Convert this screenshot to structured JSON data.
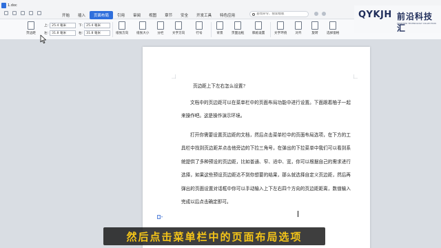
{
  "window": {
    "doc_tab": "1.doc"
  },
  "menu": {
    "tabs": [
      "开始",
      "插入",
      "页面布局",
      "引用",
      "审阅",
      "视图",
      "章节",
      "安全",
      "开发工具",
      "特色应用"
    ],
    "active_tab": "页面布局",
    "search_placeholder": "查找命令、搜索模板"
  },
  "logo": {
    "latin": "QYKJH",
    "chinese": "前沿科技汇",
    "tagline": "FRONTIER TECHNOLOGY COLLECTION"
  },
  "ribbon": {
    "page_margin_label": "页边距",
    "top_key": "上:",
    "top_value": "25.4 毫米",
    "bottom_key": "下:",
    "bottom_value": "25.4 毫米",
    "left_key": "左:",
    "left_value": "31.8 毫米",
    "right_key": "右:",
    "right_value": "31.8 毫米",
    "orientation_label": "纸张方向",
    "size_label": "纸张大小",
    "columns_label": "分栏",
    "text_direction_label": "文字方向",
    "line_number_label": "行号",
    "background_label": "背景",
    "page_border_label": "页面边框",
    "draft_label": "稿纸设置",
    "wrap_label": "文字环绕",
    "align_label": "对齐",
    "rotate_label": "旋转",
    "select_pane_label": "选择窗格"
  },
  "document": {
    "title": "页边距上下左右怎么设置?",
    "paragraph1": "文档中的页边距可以在菜单栏中的页面布局功能中进行设置。下面跟着柚子一起来操作吧。这是操作演示环境。",
    "paragraph2": "打开你需要设置页边距的文档，然后点击菜单栏中的页面布局选项，在下方的工具栏中找到页边距并点击他旁边的下拉三角号，在弹出的下拉菜单中我们可以看到系统提供了多种预设的页边距，比如普通、窄、适中、宽，你可以根据自己的需求进行选择，如果这些预设页边距达不到你想要的结果，那么就选择自定义页边距，然后再弹出的页面设置对话框中你可以手动输入上下左右四个方向的页边距距离，数值输入完成以后点击确定即可。"
  },
  "subtitle": {
    "text": "然后点击菜单栏中的页面布局选项"
  },
  "colors": {
    "accent": "#2f6fdc",
    "subtitle_text": "#f5c518",
    "logo_navy": "#1f2d5a"
  }
}
